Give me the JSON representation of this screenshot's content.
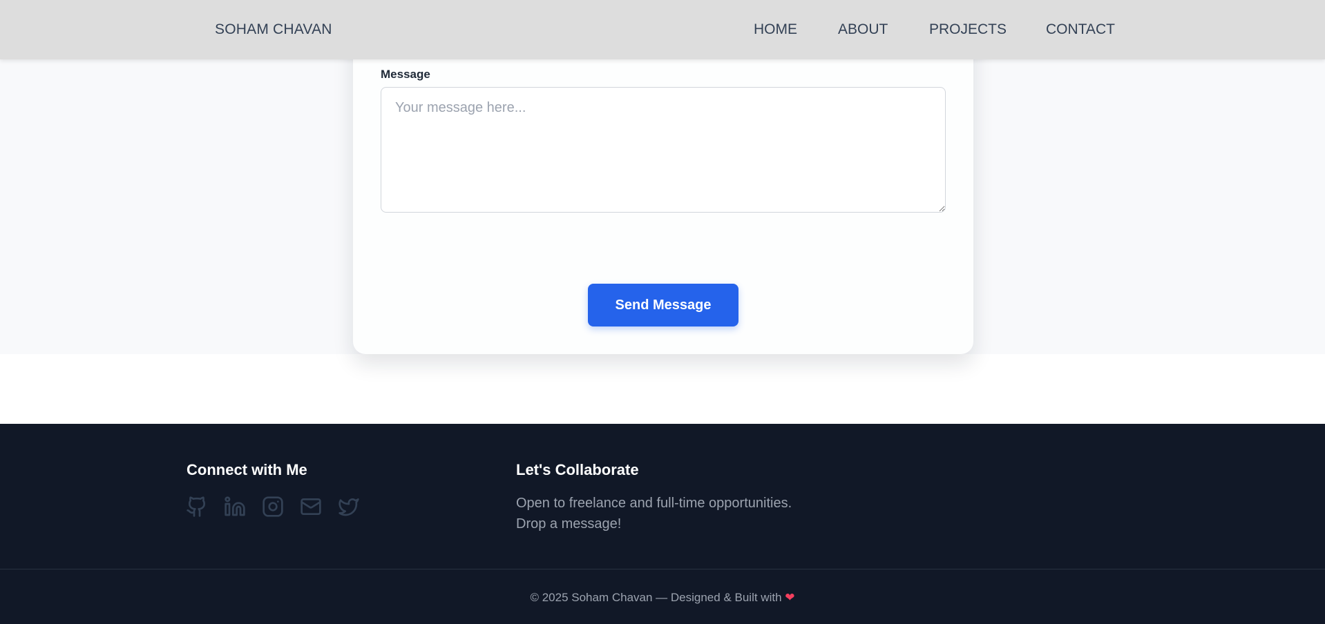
{
  "navbar": {
    "brand": "SOHAM CHAVAN",
    "links": [
      "HOME",
      "ABOUT",
      "PROJECTS",
      "CONTACT"
    ]
  },
  "form": {
    "message_label": "Message",
    "message_placeholder": "Your message here...",
    "submit_label": "Send Message"
  },
  "footer": {
    "connect_title": "Connect with Me",
    "social_icons": [
      "github-icon",
      "linkedin-icon",
      "instagram-icon",
      "mail-icon",
      "twitter-icon"
    ],
    "collab_title": "Let's Collaborate",
    "collab_line1": "Open to freelance and full-time opportunities.",
    "collab_line2": "Drop a message!",
    "copyright": "© 2025 Soham Chavan — Designed & Built with",
    "heart": "❤"
  },
  "colors": {
    "accent": "#2563eb",
    "footer_bg": "#111827",
    "navbar_bg": "#dddddd",
    "heart": "#f43f5e"
  }
}
